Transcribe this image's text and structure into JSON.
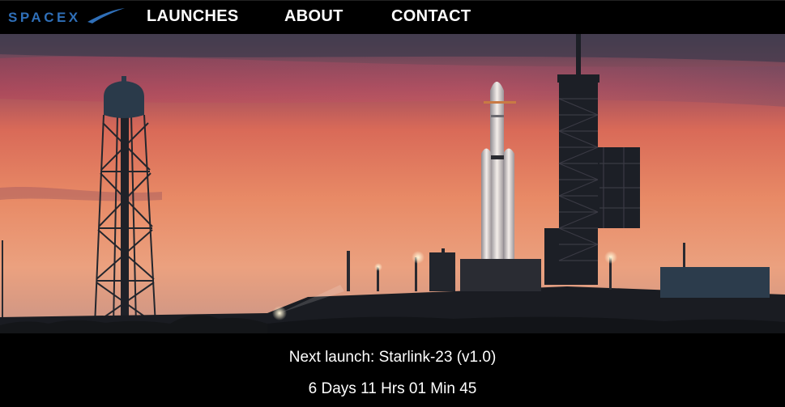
{
  "brand": {
    "logo_text": "SPACEX",
    "logo_color": "#2f6fb8"
  },
  "nav": {
    "items": [
      {
        "label": "LAUNCHES"
      },
      {
        "label": "ABOUT"
      },
      {
        "label": "CONTACT"
      }
    ]
  },
  "hero": {
    "sky_top_color": "#5a4a63",
    "sky_mid_color": "#e0755a",
    "sky_horizon_color": "#e9a07a"
  },
  "launch": {
    "next_label": "Next launch: Starlink-23 (v1.0)",
    "countdown": "6 Days 11 Hrs 01 Min 45"
  }
}
